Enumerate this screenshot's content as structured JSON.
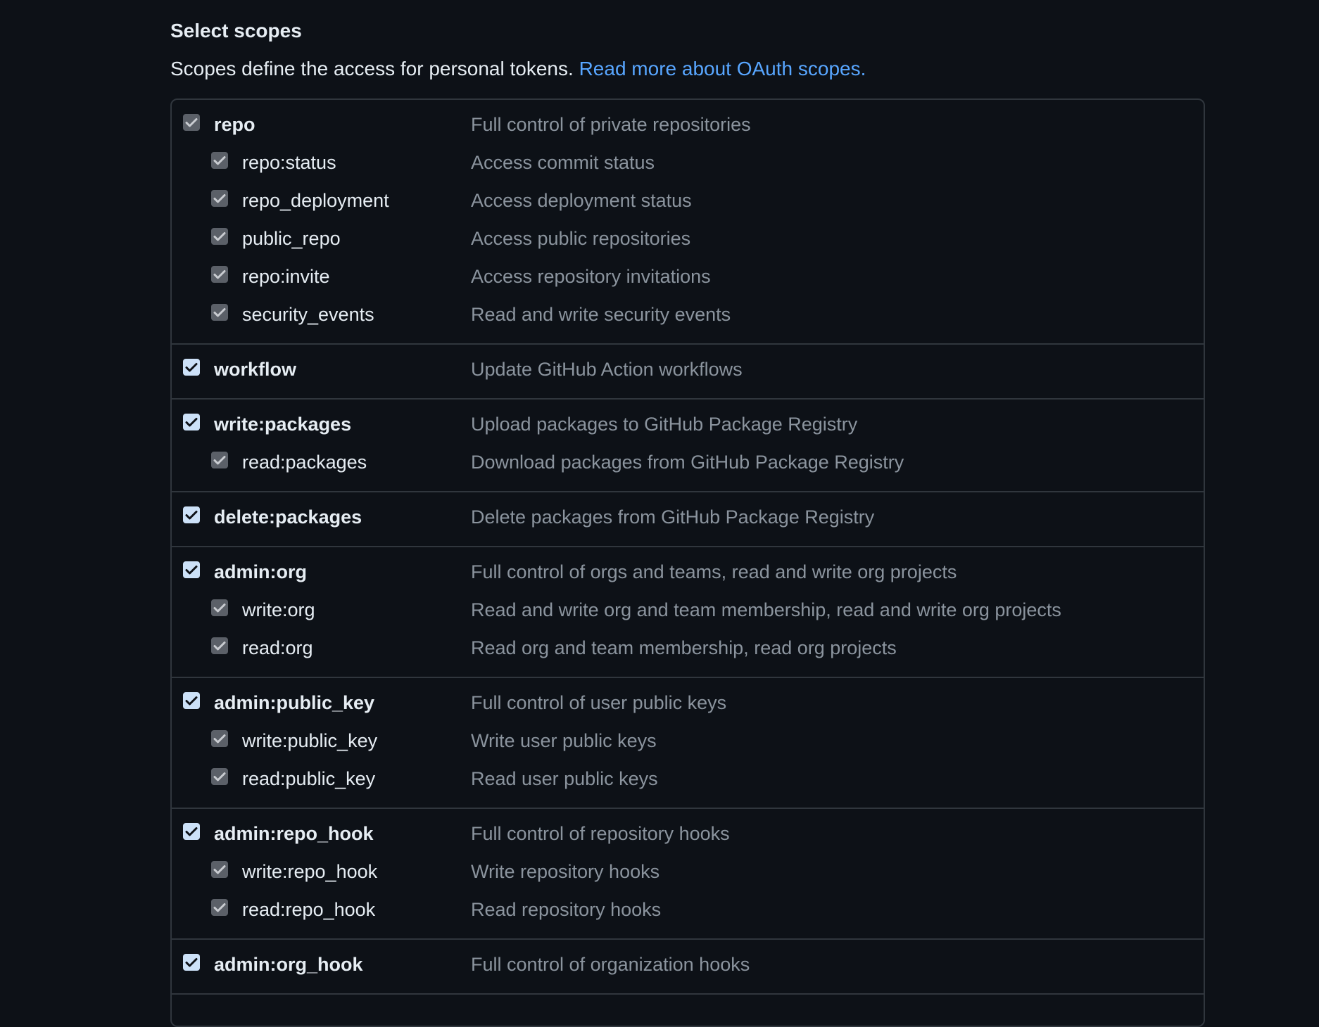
{
  "section": {
    "title": "Select scopes",
    "description": "Scopes define the access for personal tokens.",
    "link_text": "Read more about OAuth scopes."
  },
  "colors": {
    "background": "#0d1117",
    "border": "#30363d",
    "link": "#58a6ff",
    "checkbox_active": "#cce1f8",
    "checkbox_inherited": "#5b6068",
    "text_primary": "#e6edf3",
    "text_muted": "#8b949e"
  },
  "groups": [
    {
      "parent": {
        "name": "repo",
        "desc": "Full control of private repositories",
        "checked": true,
        "state": "inherited"
      },
      "children": [
        {
          "name": "repo:status",
          "desc": "Access commit status",
          "checked": true
        },
        {
          "name": "repo_deployment",
          "desc": "Access deployment status",
          "checked": true
        },
        {
          "name": "public_repo",
          "desc": "Access public repositories",
          "checked": true
        },
        {
          "name": "repo:invite",
          "desc": "Access repository invitations",
          "checked": true
        },
        {
          "name": "security_events",
          "desc": "Read and write security events",
          "checked": true
        }
      ]
    },
    {
      "parent": {
        "name": "workflow",
        "desc": "Update GitHub Action workflows",
        "checked": true,
        "state": "active"
      },
      "children": []
    },
    {
      "parent": {
        "name": "write:packages",
        "desc": "Upload packages to GitHub Package Registry",
        "checked": true,
        "state": "active"
      },
      "children": [
        {
          "name": "read:packages",
          "desc": "Download packages from GitHub Package Registry",
          "checked": true
        }
      ]
    },
    {
      "parent": {
        "name": "delete:packages",
        "desc": "Delete packages from GitHub Package Registry",
        "checked": true,
        "state": "active"
      },
      "children": []
    },
    {
      "parent": {
        "name": "admin:org",
        "desc": "Full control of orgs and teams, read and write org projects",
        "checked": true,
        "state": "active"
      },
      "children": [
        {
          "name": "write:org",
          "desc": "Read and write org and team membership, read and write org projects",
          "checked": true
        },
        {
          "name": "read:org",
          "desc": "Read org and team membership, read org projects",
          "checked": true
        }
      ]
    },
    {
      "parent": {
        "name": "admin:public_key",
        "desc": "Full control of user public keys",
        "checked": true,
        "state": "active"
      },
      "children": [
        {
          "name": "write:public_key",
          "desc": "Write user public keys",
          "checked": true
        },
        {
          "name": "read:public_key",
          "desc": "Read user public keys",
          "checked": true
        }
      ]
    },
    {
      "parent": {
        "name": "admin:repo_hook",
        "desc": "Full control of repository hooks",
        "checked": true,
        "state": "active"
      },
      "children": [
        {
          "name": "write:repo_hook",
          "desc": "Write repository hooks",
          "checked": true
        },
        {
          "name": "read:repo_hook",
          "desc": "Read repository hooks",
          "checked": true
        }
      ]
    },
    {
      "parent": {
        "name": "admin:org_hook",
        "desc": "Full control of organization hooks",
        "checked": true,
        "state": "active"
      },
      "children": []
    }
  ]
}
